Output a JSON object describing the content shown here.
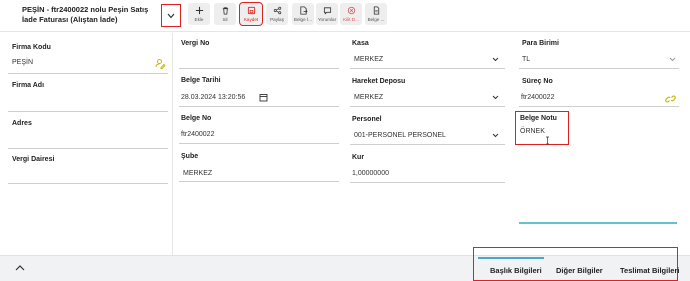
{
  "header": {
    "title": "PEŞİN - ftr2400022 nolu Peşin Satış İade Faturası (Alıştan İade)"
  },
  "toolbar": [
    {
      "label": "Ekle",
      "icon": "plus-icon"
    },
    {
      "label": "Sil",
      "icon": "trash-icon"
    },
    {
      "label": "Kaydet",
      "icon": "save-icon"
    },
    {
      "label": "Paylaş",
      "icon": "share-icon"
    },
    {
      "label": "Belge İ...",
      "icon": "document-send-icon"
    },
    {
      "label": "Yorumlar",
      "icon": "comment-icon"
    },
    {
      "label": "Kilit D...",
      "icon": "lock-circle-icon"
    },
    {
      "label": "Belge ...",
      "icon": "document-icon"
    }
  ],
  "left": {
    "firma_kodu_label": "Firma Kodu",
    "firma_kodu_value": "PEŞİN",
    "firma_adi_label": "Firma Adı",
    "adres_label": "Adres",
    "vergi_dairesi_label": "Vergi Dairesi"
  },
  "col2": {
    "vergi_no_label": "Vergi No",
    "belge_tarihi_label": "Belge Tarihi",
    "belge_tarihi_value": "28.03.2024 13:20:56",
    "belge_no_label": "Belge No",
    "belge_no_value": "ftr2400022",
    "sube_label": "Şube",
    "sube_value": "MERKEZ"
  },
  "col3": {
    "kasa_label": "Kasa",
    "kasa_value": "MERKEZ",
    "hareket_deposu_label": "Hareket Deposu",
    "hareket_deposu_value": "MERKEZ",
    "personel_label": "Personel",
    "personel_value": "001-PERSONEL PERSONEL",
    "kur_label": "Kur",
    "kur_value": "1,00000000"
  },
  "col4": {
    "para_birimi_label": "Para Birimi",
    "para_birimi_value": "TL",
    "surec_no_label": "Süreç No",
    "surec_no_value": "ftr2400022",
    "belge_notu_label": "Belge Notu",
    "belge_notu_value": "ÖRNEK"
  },
  "tabs": [
    "Başlık Bilgileri",
    "Diğer Bilgiler",
    "Teslimat Bilgileri"
  ],
  "colors": {
    "accent": "#4aa7c8",
    "highlight": "#e02020",
    "icon_yellow": "#c8b400"
  }
}
